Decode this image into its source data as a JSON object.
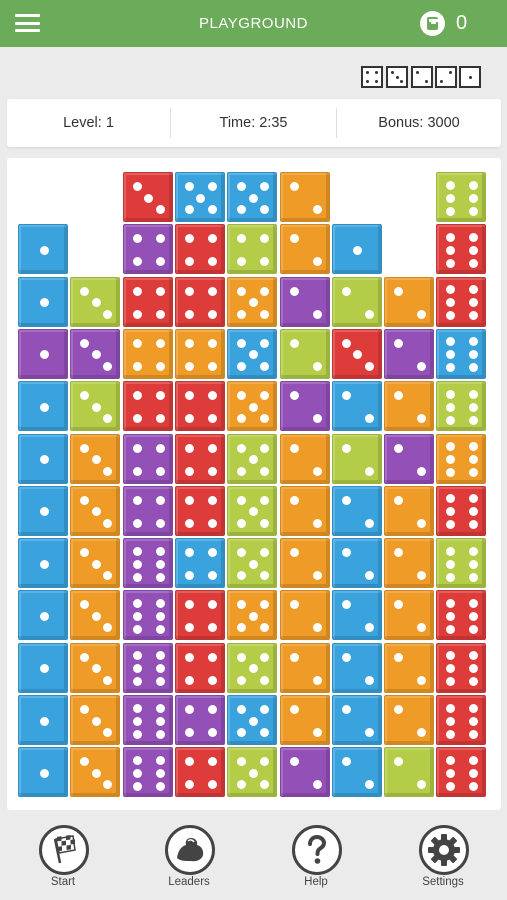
{
  "header": {
    "title": "PLAYGROUND",
    "coin_count": "0",
    "coin_letter": "G"
  },
  "target_patterns": [
    4,
    3,
    2,
    2,
    1
  ],
  "stats": {
    "level": "Level: 1",
    "time": "Time: 2:35",
    "bonus": "Bonus: 3000"
  },
  "colors": {
    "red": "#dd3c3b",
    "blue": "#3aa3de",
    "orange": "#ee9b27",
    "purple": "#9350b6",
    "green": "#b3cd48",
    "header": "#6cab59"
  },
  "board": {
    "columns": 9,
    "rows": 12,
    "cells": [
      [
        null,
        null,
        [
          "red",
          3
        ],
        [
          "blue",
          5
        ],
        [
          "blue",
          5
        ],
        [
          "orange",
          2
        ],
        null,
        null,
        [
          "green",
          6
        ]
      ],
      [
        [
          "blue",
          1
        ],
        null,
        [
          "purple",
          4
        ],
        [
          "red",
          4
        ],
        [
          "green",
          4
        ],
        [
          "orange",
          2
        ],
        [
          "blue",
          1
        ],
        null,
        [
          "red",
          6
        ]
      ],
      [
        [
          "blue",
          1
        ],
        [
          "green",
          3
        ],
        [
          "red",
          4
        ],
        [
          "red",
          4
        ],
        [
          "orange",
          5
        ],
        [
          "purple",
          2
        ],
        [
          "green",
          2
        ],
        [
          "orange",
          2
        ],
        [
          "red",
          6
        ]
      ],
      [
        [
          "purple",
          1
        ],
        [
          "purple",
          3
        ],
        [
          "orange",
          4
        ],
        [
          "orange",
          4
        ],
        [
          "blue",
          5
        ],
        [
          "green",
          2
        ],
        [
          "red",
          3
        ],
        [
          "purple",
          2
        ],
        [
          "blue",
          6
        ]
      ],
      [
        [
          "blue",
          1
        ],
        [
          "green",
          3
        ],
        [
          "red",
          4
        ],
        [
          "red",
          4
        ],
        [
          "orange",
          5
        ],
        [
          "purple",
          2
        ],
        [
          "blue",
          2
        ],
        [
          "orange",
          2
        ],
        [
          "green",
          6
        ]
      ],
      [
        [
          "blue",
          1
        ],
        [
          "orange",
          3
        ],
        [
          "purple",
          4
        ],
        [
          "red",
          4
        ],
        [
          "green",
          5
        ],
        [
          "orange",
          2
        ],
        [
          "green",
          2
        ],
        [
          "purple",
          2
        ],
        [
          "orange",
          6
        ]
      ],
      [
        [
          "blue",
          1
        ],
        [
          "orange",
          3
        ],
        [
          "purple",
          4
        ],
        [
          "red",
          4
        ],
        [
          "green",
          5
        ],
        [
          "orange",
          2
        ],
        [
          "blue",
          2
        ],
        [
          "orange",
          2
        ],
        [
          "red",
          6
        ]
      ],
      [
        [
          "blue",
          1
        ],
        [
          "orange",
          3
        ],
        [
          "purple",
          6
        ],
        [
          "blue",
          4
        ],
        [
          "green",
          5
        ],
        [
          "orange",
          2
        ],
        [
          "blue",
          2
        ],
        [
          "orange",
          2
        ],
        [
          "green",
          6
        ]
      ],
      [
        [
          "blue",
          1
        ],
        [
          "orange",
          3
        ],
        [
          "purple",
          6
        ],
        [
          "red",
          4
        ],
        [
          "orange",
          5
        ],
        [
          "orange",
          2
        ],
        [
          "blue",
          2
        ],
        [
          "orange",
          2
        ],
        [
          "red",
          6
        ]
      ],
      [
        [
          "blue",
          1
        ],
        [
          "orange",
          3
        ],
        [
          "purple",
          6
        ],
        [
          "red",
          4
        ],
        [
          "green",
          5
        ],
        [
          "orange",
          2
        ],
        [
          "blue",
          2
        ],
        [
          "orange",
          2
        ],
        [
          "red",
          6
        ]
      ],
      [
        [
          "blue",
          1
        ],
        [
          "orange",
          3
        ],
        [
          "purple",
          6
        ],
        [
          "purple",
          4
        ],
        [
          "blue",
          5
        ],
        [
          "orange",
          2
        ],
        [
          "blue",
          2
        ],
        [
          "orange",
          2
        ],
        [
          "red",
          6
        ]
      ],
      [
        [
          "blue",
          1
        ],
        [
          "orange",
          3
        ],
        [
          "purple",
          6
        ],
        [
          "red",
          4
        ],
        [
          "green",
          5
        ],
        [
          "purple",
          2
        ],
        [
          "blue",
          2
        ],
        [
          "green",
          2
        ],
        [
          "red",
          6
        ]
      ]
    ]
  },
  "nav": {
    "start": {
      "label": "Start",
      "icon": "checkered-flag-icon"
    },
    "leaders": {
      "label": "Leaders",
      "icon": "flexed-arm-icon"
    },
    "help": {
      "label": "Help",
      "icon": "question-mark-icon"
    },
    "settings": {
      "label": "Settings",
      "icon": "gear-icon"
    }
  }
}
